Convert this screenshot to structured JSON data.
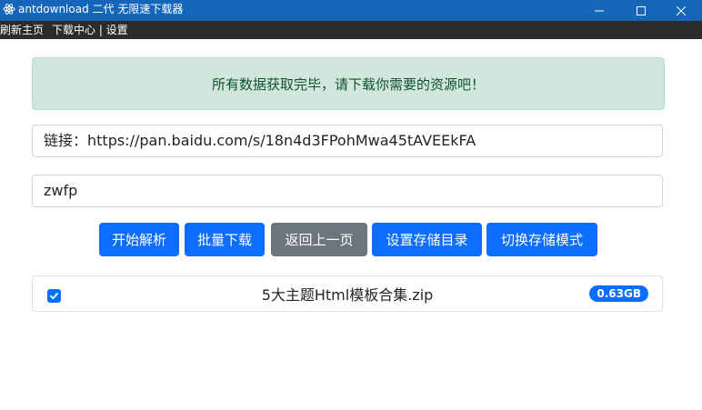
{
  "window": {
    "title": "antdownload 二代 无限速下载器",
    "icon": "electron-icon",
    "controls": [
      "minimize-icon",
      "maximize-icon",
      "close-icon"
    ]
  },
  "menu": {
    "items": [
      {
        "label": "刷新主页"
      },
      {
        "label": "下载中心 | 设置"
      }
    ]
  },
  "alert": {
    "message": "所有数据获取完毕，请下载你需要的资源吧！"
  },
  "link_field": {
    "value": "链接：https://pan.baidu.com/s/18n4d3FPohMwa45tAVEEkFA"
  },
  "code_field": {
    "value": "zwfp"
  },
  "buttons": {
    "parse": "开始解析",
    "batch_download": "批量下载",
    "back": "返回上一页",
    "set_dir": "设置存储目录",
    "switch_mode": "切换存储模式"
  },
  "files": [
    {
      "name": "5大主题Html模板合集.zip",
      "size": "0.63GB",
      "checked": true
    }
  ],
  "colors": {
    "titlebar": "#1565b8",
    "menubar": "#2b2b2b",
    "primary": "#0d6efd",
    "secondary": "#6c757d",
    "alert_bg": "#d1e7dd",
    "alert_text": "#0f5132"
  }
}
